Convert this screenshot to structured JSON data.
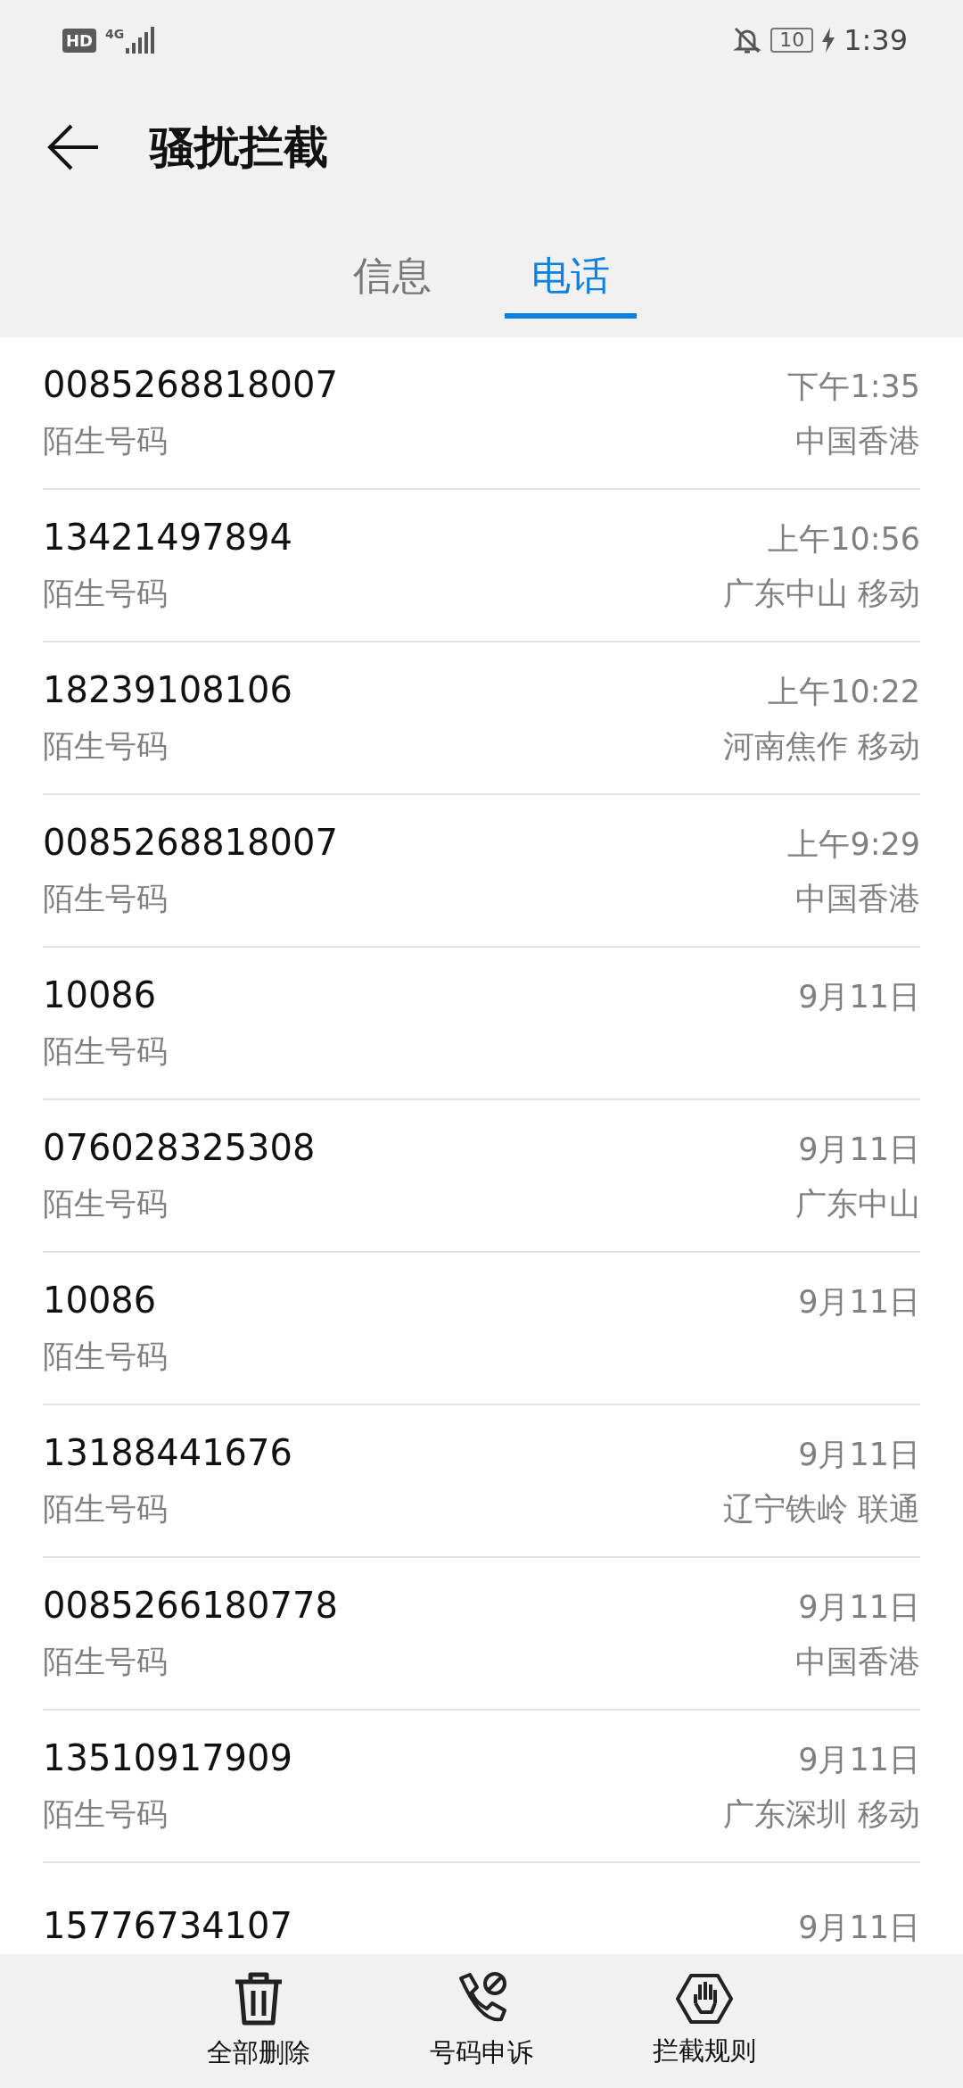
{
  "status_bar": {
    "hd_badge": "HD",
    "network": "4G",
    "battery": "10",
    "charging": true,
    "time": "1:39"
  },
  "header": {
    "title": "骚扰拦截"
  },
  "tabs": [
    {
      "label": "信息",
      "selected": false
    },
    {
      "label": "电话",
      "selected": true
    }
  ],
  "calls": [
    {
      "number": "0085268818007",
      "label": "陌生号码",
      "time": "下午1:35",
      "location": "中国香港"
    },
    {
      "number": "13421497894",
      "label": "陌生号码",
      "time": "上午10:56",
      "location": "广东中山 移动"
    },
    {
      "number": "18239108106",
      "label": "陌生号码",
      "time": "上午10:22",
      "location": "河南焦作 移动"
    },
    {
      "number": "0085268818007",
      "label": "陌生号码",
      "time": "上午9:29",
      "location": "中国香港"
    },
    {
      "number": "10086",
      "label": "陌生号码",
      "time": "9月11日"
    },
    {
      "number": "076028325308",
      "label": "陌生号码",
      "time": "9月11日",
      "location": "广东中山"
    },
    {
      "number": "10086",
      "label": "陌生号码",
      "time": "9月11日"
    },
    {
      "number": "13188441676",
      "label": "陌生号码",
      "time": "9月11日",
      "location": "辽宁铁岭 联通"
    },
    {
      "number": "0085266180778",
      "label": "陌生号码",
      "time": "9月11日",
      "location": "中国香港"
    },
    {
      "number": "13510917909",
      "label": "陌生号码",
      "time": "9月11日",
      "location": "广东深圳 移动"
    },
    {
      "number": "15776734107",
      "time": "9月11日"
    }
  ],
  "bottom_actions": [
    {
      "kind": "delete",
      "label": "全部删除"
    },
    {
      "kind": "appeal",
      "label": "号码申诉"
    },
    {
      "kind": "rules",
      "label": "拦截规则"
    }
  ]
}
